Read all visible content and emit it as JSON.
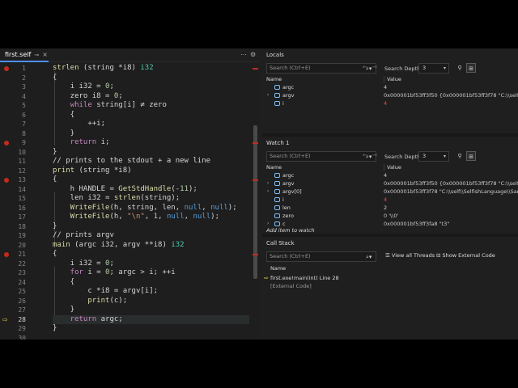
{
  "editor": {
    "tab": {
      "label": "first.self",
      "pin": "📌",
      "close": "×"
    },
    "current_line": 28,
    "lines": [
      {
        "n": "1",
        "segs": [
          [
            "fn",
            "strlen"
          ],
          [
            "p",
            " (string *i8) "
          ],
          [
            "ty",
            "i32"
          ]
        ]
      },
      {
        "n": "2",
        "segs": [
          [
            "p",
            "{"
          ]
        ]
      },
      {
        "n": "3",
        "segs": [
          [
            "p",
            "    i i32 = "
          ],
          [
            "nu",
            "0"
          ],
          [
            "p",
            ";"
          ]
        ]
      },
      {
        "n": "4",
        "segs": [
          [
            "p",
            "    zero i8 = "
          ],
          [
            "nu",
            "0"
          ],
          [
            "p",
            ";"
          ]
        ]
      },
      {
        "n": "5",
        "segs": [
          [
            "ctl",
            "    while"
          ],
          [
            "p",
            " string[i] ≠ zero"
          ]
        ]
      },
      {
        "n": "6",
        "segs": [
          [
            "p",
            "    {"
          ]
        ]
      },
      {
        "n": "7",
        "segs": [
          [
            "p",
            "        ++i;"
          ]
        ]
      },
      {
        "n": "8",
        "segs": [
          [
            "p",
            "    }"
          ]
        ]
      },
      {
        "n": "9",
        "segs": [
          [
            "ctl",
            "    return"
          ],
          [
            "p",
            " i;"
          ]
        ]
      },
      {
        "n": "10",
        "segs": [
          [
            "p",
            "}"
          ]
        ]
      },
      {
        "n": "11",
        "segs": [
          [
            "cm",
            "// prints to the stdout + a new line"
          ]
        ]
      },
      {
        "n": "12",
        "segs": [
          [
            "fn",
            "print"
          ],
          [
            "p",
            " (string *i8)"
          ]
        ]
      },
      {
        "n": "13",
        "segs": [
          [
            "p",
            "{"
          ]
        ]
      },
      {
        "n": "14",
        "segs": [
          [
            "p",
            "    h HANDLE = "
          ],
          [
            "fn",
            "GetStdHandle"
          ],
          [
            "p",
            "(-"
          ],
          [
            "nu",
            "11"
          ],
          [
            "p",
            ");"
          ]
        ]
      },
      {
        "n": "15",
        "segs": [
          [
            "p",
            "    len i32 = "
          ],
          [
            "fn",
            "strlen"
          ],
          [
            "p",
            "(string);"
          ]
        ]
      },
      {
        "n": "16",
        "segs": [
          [
            "fn",
            "    WriteFile"
          ],
          [
            "p",
            "(h, string, len, "
          ],
          [
            "kw",
            "null"
          ],
          [
            "p",
            ", "
          ],
          [
            "kw",
            "null"
          ],
          [
            "p",
            ");"
          ]
        ]
      },
      {
        "n": "17",
        "segs": [
          [
            "fn",
            "    WriteFile"
          ],
          [
            "p",
            "(h, "
          ],
          [
            "st",
            "\"\\n\""
          ],
          [
            "p",
            ", "
          ],
          [
            "nu",
            "1"
          ],
          [
            "p",
            ", "
          ],
          [
            "kw",
            "null"
          ],
          [
            "p",
            ", "
          ],
          [
            "kw",
            "null"
          ],
          [
            "p",
            ");"
          ]
        ]
      },
      {
        "n": "18",
        "segs": [
          [
            "p",
            "}"
          ]
        ]
      },
      {
        "n": "19",
        "segs": [
          [
            "cm",
            "// prints argv"
          ]
        ]
      },
      {
        "n": "20",
        "segs": [
          [
            "fn",
            "main"
          ],
          [
            "p",
            " (argc i32, argv **i8) "
          ],
          [
            "ty",
            "i32"
          ]
        ]
      },
      {
        "n": "21",
        "segs": [
          [
            "p",
            "{"
          ]
        ]
      },
      {
        "n": "22",
        "segs": [
          [
            "p",
            "    i i32 = "
          ],
          [
            "nu",
            "0"
          ],
          [
            "p",
            ";"
          ]
        ]
      },
      {
        "n": "23",
        "segs": [
          [
            "ctl",
            "    for"
          ],
          [
            "p",
            " i = "
          ],
          [
            "nu",
            "0"
          ],
          [
            "p",
            "; argc > i; ++i"
          ]
        ]
      },
      {
        "n": "24",
        "segs": [
          [
            "p",
            "    {"
          ]
        ]
      },
      {
        "n": "25",
        "segs": [
          [
            "p",
            "        c *i8 = argv[i];"
          ]
        ]
      },
      {
        "n": "26",
        "segs": [
          [
            "fn",
            "        print"
          ],
          [
            "p",
            "(c);"
          ]
        ]
      },
      {
        "n": "27",
        "segs": [
          [
            "p",
            "    }"
          ]
        ]
      },
      {
        "n": "28",
        "segs": [
          [
            "ctl",
            "    return"
          ],
          [
            "p",
            " argc;"
          ]
        ]
      },
      {
        "n": "29",
        "segs": [
          [
            "p",
            "}"
          ]
        ]
      },
      {
        "n": "30",
        "segs": [
          [
            "p",
            ""
          ]
        ]
      }
    ],
    "breakpoints": [
      "1",
      "9",
      "13",
      "21"
    ],
    "arrow_glyph": "⇨"
  },
  "locals": {
    "title": "Locals",
    "search_placeholder": "Search (Ctrl+E)",
    "search_depth_label": "Search Depth:",
    "search_depth": "3",
    "col_name": "Name",
    "col_value": "Value",
    "rows": [
      {
        "exp": "",
        "name": "argc",
        "value": "4",
        "changed": false
      },
      {
        "exp": "›",
        "name": "argv",
        "value": "0x000001bf53ff3f50 {0x000001bf53ff3f78 \"C:\\\\self\\\\Selfis",
        "changed": false
      },
      {
        "exp": "",
        "name": "i",
        "value": "4",
        "changed": true
      }
    ]
  },
  "watch": {
    "title": "Watch 1",
    "search_placeholder": "Search (Ctrl+E)",
    "search_depth_label": "Search Depth:",
    "search_depth": "3",
    "col_name": "Name",
    "col_value": "Value",
    "rows": [
      {
        "exp": "",
        "name": "argc",
        "value": "4",
        "changed": false
      },
      {
        "exp": "›",
        "name": "argv",
        "value": "0x000001bf53ff3f50 {0x000001bf53ff3f78 \"C:\\\\self\\\\Selfis",
        "changed": false
      },
      {
        "exp": "›",
        "name": "argv[0]",
        "value": "0x000001bf53ff3f78 \"C:\\\\self\\\\SelfishLanguage\\\\Samp",
        "changed": false
      },
      {
        "exp": "",
        "name": "i",
        "value": "4",
        "changed": true
      },
      {
        "exp": "",
        "name": "len",
        "value": "2",
        "changed": false
      },
      {
        "exp": "",
        "name": "zero",
        "value": "0 '\\\\0'",
        "changed": false
      },
      {
        "exp": "›",
        "name": "c",
        "value": "0x000001bf53ff3fa8 \"t3\"",
        "changed": false
      }
    ],
    "add_item": "Add item to watch"
  },
  "callstack": {
    "title": "Call Stack",
    "search_placeholder": "Search (Ctrl+E)",
    "view_all_threads": "View all Threads",
    "show_external_code": "Show External Code",
    "col_name": "Name",
    "rows": [
      {
        "text": "first.exe!main(int) Line 28",
        "current": true
      },
      {
        "text": "[External Code]",
        "current": false
      }
    ]
  },
  "colors": {
    "accent": "#4f8ff7",
    "breakpoint": "#c42b1c",
    "changed_value": "#f14c4c",
    "current_arrow": "#f3d34a"
  }
}
